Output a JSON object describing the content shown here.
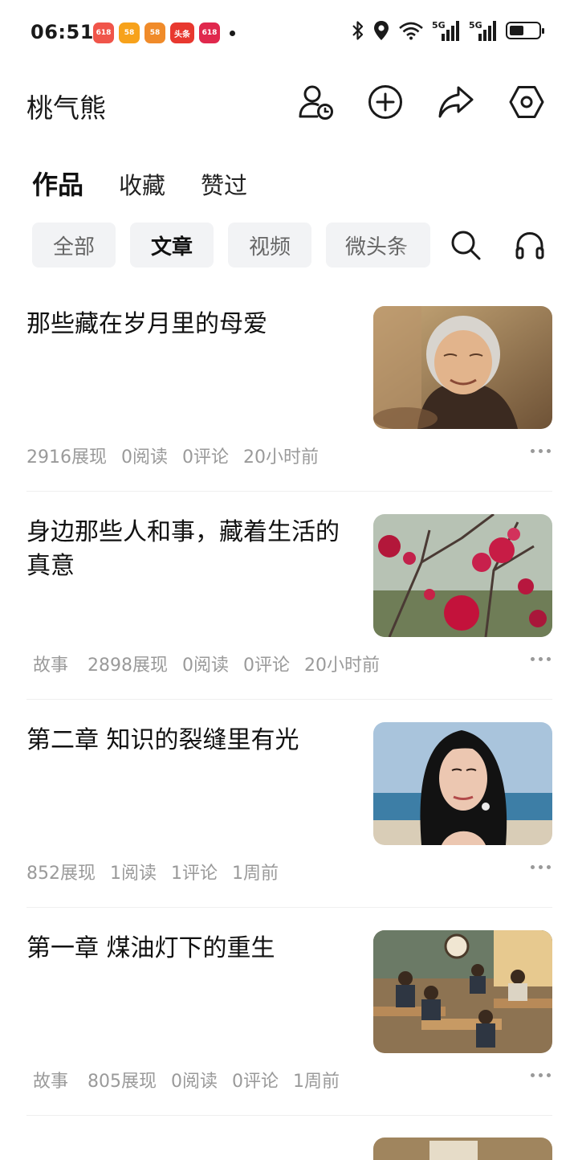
{
  "status_bar": {
    "time": "06:51",
    "app_icons": [
      {
        "label": "618",
        "color": "#f0554a"
      },
      {
        "label": "58",
        "color": "#f7a21b"
      },
      {
        "label": "58",
        "color": "#f08b2a"
      },
      {
        "label": "头条",
        "color": "#e8382f"
      },
      {
        "label": "618",
        "color": "#e0284d"
      }
    ],
    "network": "5G",
    "battery_level": 0.52
  },
  "header": {
    "username": "桃气熊",
    "icons": [
      "profile-history-icon",
      "add-circle-icon",
      "share-icon",
      "settings-icon"
    ]
  },
  "tabs": [
    {
      "label": "作品",
      "active": true
    },
    {
      "label": "收藏",
      "active": false
    },
    {
      "label": "赞过",
      "active": false
    }
  ],
  "filters": [
    {
      "label": "全部",
      "active": false
    },
    {
      "label": "文章",
      "active": true
    },
    {
      "label": "视频",
      "active": false
    },
    {
      "label": "微头条",
      "active": false
    }
  ],
  "articles": [
    {
      "title": "那些藏在岁月里的母爱",
      "tag": "",
      "impressions": "2916展现",
      "reads": "0阅读",
      "comments": "0评论",
      "time": "20小时前",
      "thumb": "elderly-woman-portrait"
    },
    {
      "title": "身边那些人和事，藏着生活的真意",
      "tag": "故事",
      "impressions": "2898展现",
      "reads": "0阅读",
      "comments": "0评论",
      "time": "20小时前",
      "thumb": "red-blossoms"
    },
    {
      "title": "第二章 知识的裂缝里有光",
      "tag": "",
      "impressions": "852展现",
      "reads": "1阅读",
      "comments": "1评论",
      "time": "1周前",
      "thumb": "woman-by-sea"
    },
    {
      "title": "第一章 煤油灯下的重生",
      "tag": "故事",
      "impressions": "805展现",
      "reads": "0阅读",
      "comments": "0评论",
      "time": "1周前",
      "thumb": "classroom-students"
    }
  ]
}
